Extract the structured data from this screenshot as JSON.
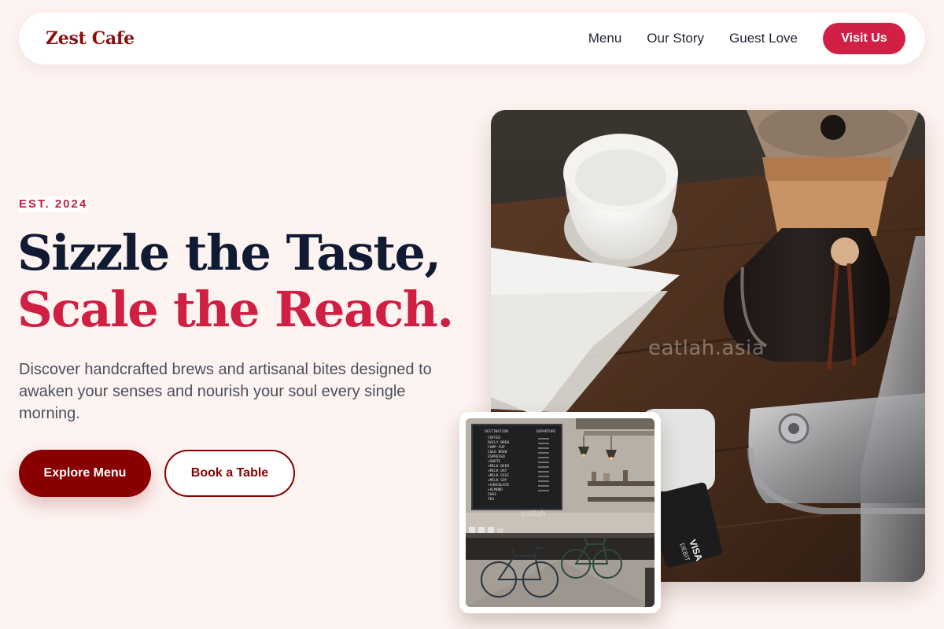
{
  "nav": {
    "brand": "Zest Cafe",
    "links": [
      "Menu",
      "Our Story",
      "Guest Love"
    ],
    "cta": "Visit Us"
  },
  "hero": {
    "eyebrow": "EST. 2024",
    "headline_line1": "Sizzle the Taste,",
    "headline_line2": "Scale the Reach.",
    "subcopy": "Discover handcrafted brews and artisanal bites designed to awaken your senses and nourish your soul every single morning.",
    "primary_button": "Explore Menu",
    "secondary_button": "Book a Table"
  },
  "images": {
    "main_watermark": "eatlah.asia",
    "main_card_text": "VISA",
    "main_card_subtext": "DEBIT",
    "inset_board_header_left": "DESTINATION",
    "inset_board_header_right": "DEPARTURE",
    "inset_board_items": [
      "COFFEE",
      "DAILY BREW",
      "CAMP CUP",
      "COLD BREW",
      "ESPRESSO",
      "+SHOTS",
      "+MILK BEER",
      "+MILK OAT",
      "+MILK RICE",
      "+MILK SOY",
      "+CHOCOLATE",
      "+ALMOND",
      "CHAI",
      "TEA"
    ],
    "inset_watermark": "eatlah"
  },
  "colors": {
    "background": "#fdf3f1",
    "brand": "#8a0f0f",
    "accent": "#d21f45",
    "primary_button": "#8a0000",
    "headline_dark": "#111a33"
  }
}
